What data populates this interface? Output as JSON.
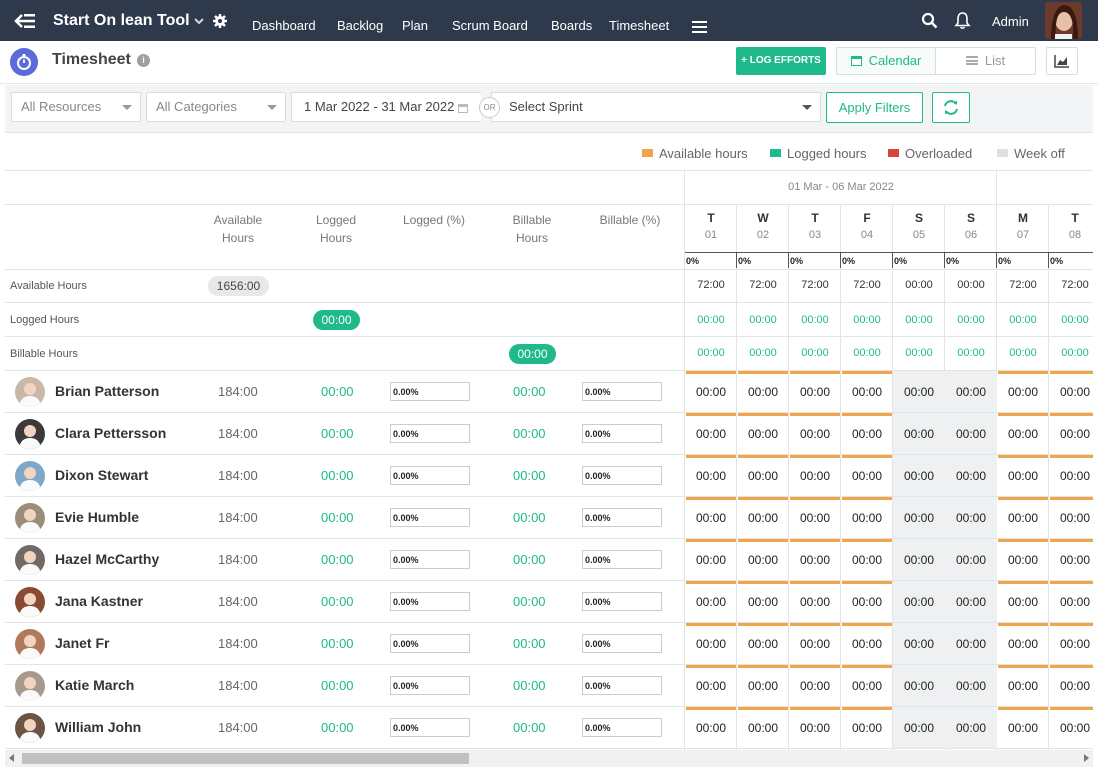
{
  "app": {
    "title": "Start On lean Tool",
    "nav": [
      "Dashboard",
      "Backlog",
      "Plan",
      "Scrum Board",
      "Boards",
      "Timesheet"
    ],
    "user": "Admin"
  },
  "page": {
    "title": "Timesheet",
    "log_button": "+ LOG EFFORTS",
    "view_calendar": "Calendar",
    "view_list": "List"
  },
  "filters": {
    "resources": "All Resources",
    "categories": "All Categories",
    "date_range": "1 Mar 2022 - 31 Mar 2022",
    "or": "OR",
    "sprint": "Select Sprint",
    "apply": "Apply Filters"
  },
  "legend": [
    {
      "label": "Available hours",
      "color": "#f0a54a"
    },
    {
      "label": "Logged hours",
      "color": "#1fb98b"
    },
    {
      "label": "Overloaded",
      "color": "#d9443a"
    },
    {
      "label": "Week off",
      "color": "#e0e0e0"
    }
  ],
  "columns": {
    "available_hours": "Available Hours",
    "logged_hours": "Logged Hours",
    "logged_pct": "Logged (%)",
    "billable_hours": "Billable Hours",
    "billable_pct": "Billable (%)"
  },
  "week_label": "01 Mar - 06 Mar 2022",
  "days": [
    {
      "letter": "T",
      "num": "01",
      "pct": "0%",
      "avail": "72:00",
      "logged": "00:00",
      "billable": "00:00",
      "weekend": false
    },
    {
      "letter": "W",
      "num": "02",
      "pct": "0%",
      "avail": "72:00",
      "logged": "00:00",
      "billable": "00:00",
      "weekend": false
    },
    {
      "letter": "T",
      "num": "03",
      "pct": "0%",
      "avail": "72:00",
      "logged": "00:00",
      "billable": "00:00",
      "weekend": false
    },
    {
      "letter": "F",
      "num": "04",
      "pct": "0%",
      "avail": "72:00",
      "logged": "00:00",
      "billable": "00:00",
      "weekend": false
    },
    {
      "letter": "S",
      "num": "05",
      "pct": "0%",
      "avail": "00:00",
      "logged": "00:00",
      "billable": "00:00",
      "weekend": true
    },
    {
      "letter": "S",
      "num": "06",
      "pct": "0%",
      "avail": "00:00",
      "logged": "00:00",
      "billable": "00:00",
      "weekend": true
    },
    {
      "letter": "M",
      "num": "07",
      "pct": "0%",
      "avail": "72:00",
      "logged": "00:00",
      "billable": "00:00",
      "weekend": false
    },
    {
      "letter": "T",
      "num": "08",
      "pct": "0%",
      "avail": "72:00",
      "logged": "00:00",
      "billable": "00:00",
      "weekend": false
    }
  ],
  "summary": {
    "available_label": "Available Hours",
    "available_total": "1656:00",
    "logged_label": "Logged Hours",
    "logged_total": "00:00",
    "billable_label": "Billable Hours",
    "billable_total": "00:00"
  },
  "resources": [
    {
      "name": "Brian Patterson",
      "available": "184:00",
      "logged": "00:00",
      "logged_pct": "0.00%",
      "billable": "00:00",
      "billable_pct": "0.00%",
      "day_value": "00:00",
      "avatar_color": "#c9b8a8"
    },
    {
      "name": "Clara Pettersson",
      "available": "184:00",
      "logged": "00:00",
      "logged_pct": "0.00%",
      "billable": "00:00",
      "billable_pct": "0.00%",
      "day_value": "00:00",
      "avatar_color": "#3a3a3a"
    },
    {
      "name": "Dixon Stewart",
      "available": "184:00",
      "logged": "00:00",
      "logged_pct": "0.00%",
      "billable": "00:00",
      "billable_pct": "0.00%",
      "day_value": "00:00",
      "avatar_color": "#7fa8c8"
    },
    {
      "name": "Evie Humble",
      "available": "184:00",
      "logged": "00:00",
      "logged_pct": "0.00%",
      "billable": "00:00",
      "billable_pct": "0.00%",
      "day_value": "00:00",
      "avatar_color": "#9c8c7a"
    },
    {
      "name": "Hazel McCarthy",
      "available": "184:00",
      "logged": "00:00",
      "logged_pct": "0.00%",
      "billable": "00:00",
      "billable_pct": "0.00%",
      "day_value": "00:00",
      "avatar_color": "#6f6a66"
    },
    {
      "name": "Jana Kastner",
      "available": "184:00",
      "logged": "00:00",
      "logged_pct": "0.00%",
      "billable": "00:00",
      "billable_pct": "0.00%",
      "day_value": "00:00",
      "avatar_color": "#8a4a32"
    },
    {
      "name": "Janet Fr",
      "available": "184:00",
      "logged": "00:00",
      "logged_pct": "0.00%",
      "billable": "00:00",
      "billable_pct": "0.00%",
      "day_value": "00:00",
      "avatar_color": "#b07a5a"
    },
    {
      "name": "Katie March",
      "available": "184:00",
      "logged": "00:00",
      "logged_pct": "0.00%",
      "billable": "00:00",
      "billable_pct": "0.00%",
      "day_value": "00:00",
      "avatar_color": "#a69a8c"
    },
    {
      "name": "William John",
      "available": "184:00",
      "logged": "00:00",
      "logged_pct": "0.00%",
      "billable": "00:00",
      "billable_pct": "0.00%",
      "day_value": "00:00",
      "avatar_color": "#6b5444"
    }
  ]
}
